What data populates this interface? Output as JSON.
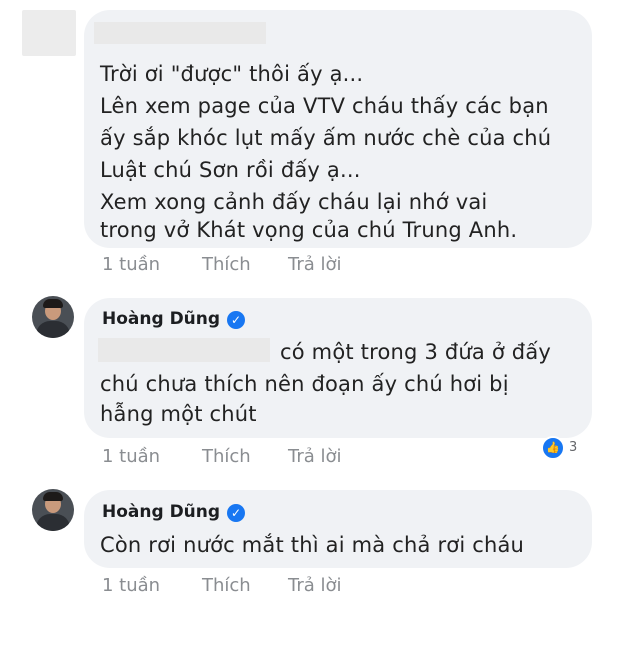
{
  "comment1": {
    "lines": [
      "Trời ơi \"được\" thôi ấy ạ...",
      "Lên xem page của VTV cháu thấy các bạn",
      "ấy sắp khóc lụt mấy ấm nước chè của chú",
      "Luật chú Sơn rồi đấy ạ...",
      "Xem xong cảnh đấy cháu lại nhớ vai",
      "trong vở Khát vọng của chú Trung Anh."
    ],
    "time": "1 tuần",
    "like": "Thích",
    "reply": "Trả lời"
  },
  "comment2": {
    "author": "Hoàng Dũng",
    "lines": [
      "có một trong 3 đứa ở đấy",
      "chú chưa thích nên đoạn ấy chú hơi bị",
      "hẫng một chút"
    ],
    "reaction_count": "3",
    "time": "1 tuần",
    "like": "Thích",
    "reply": "Trả lời"
  },
  "comment3": {
    "author": "Hoàng Dũng",
    "lines": [
      "Còn rơi nước mắt thì ai mà chả rơi cháu"
    ],
    "time": "1 tuần",
    "like": "Thích",
    "reply": "Trả lời"
  },
  "colors": {
    "bubble": "#f0f2f5",
    "meta": "#8a8d91",
    "verified": "#1877f2"
  }
}
